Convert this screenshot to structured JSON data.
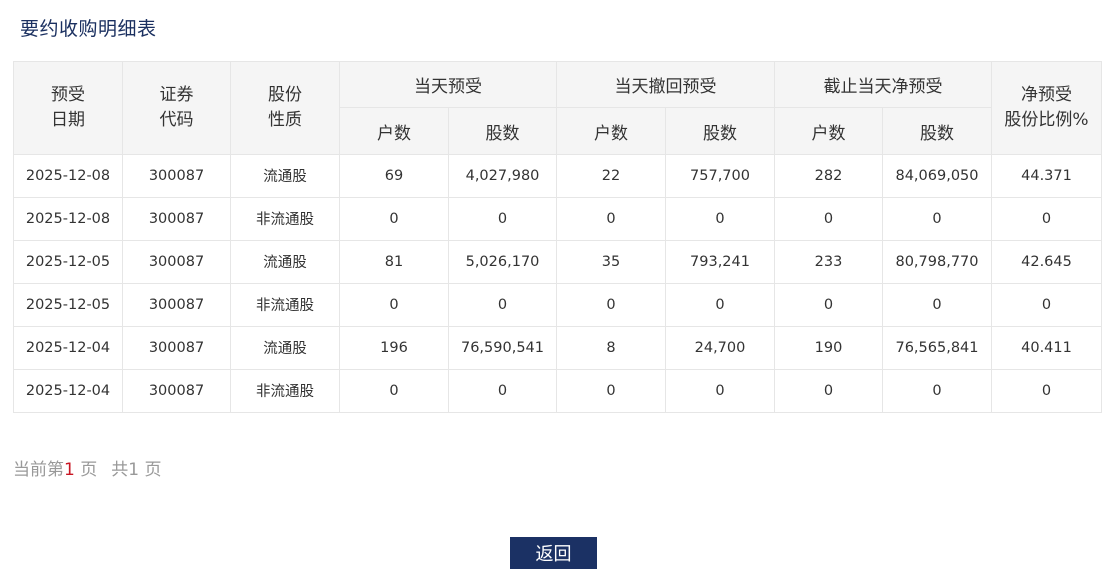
{
  "page": {
    "title": "要约收购明细表"
  },
  "table": {
    "headers": {
      "date_line1": "预受",
      "date_line2": "日期",
      "code_line1": "证券",
      "code_line2": "代码",
      "nature_line1": "股份",
      "nature_line2": "性质",
      "group_today_accept": "当天预受",
      "group_today_withdraw": "当天撤回预受",
      "group_net_accept": "截止当天净预受",
      "ratio_line1": "净预受",
      "ratio_line2": "股份比例%",
      "households": "户数",
      "shares": "股数"
    },
    "rows": [
      [
        "2025-12-08",
        "300087",
        "流通股",
        "69",
        "4,027,980",
        "22",
        "757,700",
        "282",
        "84,069,050",
        "44.371"
      ],
      [
        "2025-12-08",
        "300087",
        "非流通股",
        "0",
        "0",
        "0",
        "0",
        "0",
        "0",
        "0"
      ],
      [
        "2025-12-05",
        "300087",
        "流通股",
        "81",
        "5,026,170",
        "35",
        "793,241",
        "233",
        "80,798,770",
        "42.645"
      ],
      [
        "2025-12-05",
        "300087",
        "非流通股",
        "0",
        "0",
        "0",
        "0",
        "0",
        "0",
        "0"
      ],
      [
        "2025-12-04",
        "300087",
        "流通股",
        "196",
        "76,590,541",
        "8",
        "24,700",
        "190",
        "76,565,841",
        "40.411"
      ],
      [
        "2025-12-04",
        "300087",
        "非流通股",
        "0",
        "0",
        "0",
        "0",
        "0",
        "0",
        "0"
      ]
    ]
  },
  "pagination": {
    "current_prefix": "当前第",
    "current_page": "1",
    "current_suffix": " 页",
    "total_prefix": "共1",
    "total_suffix": " 页"
  },
  "actions": {
    "back_label": "返回"
  },
  "colors": {
    "title": "#1b3060",
    "header_bg": "#f5f5f5",
    "border": "#e6e6e6",
    "pager_text": "#999999",
    "pager_current": "#c81623",
    "button_bg": "#1b3164"
  }
}
